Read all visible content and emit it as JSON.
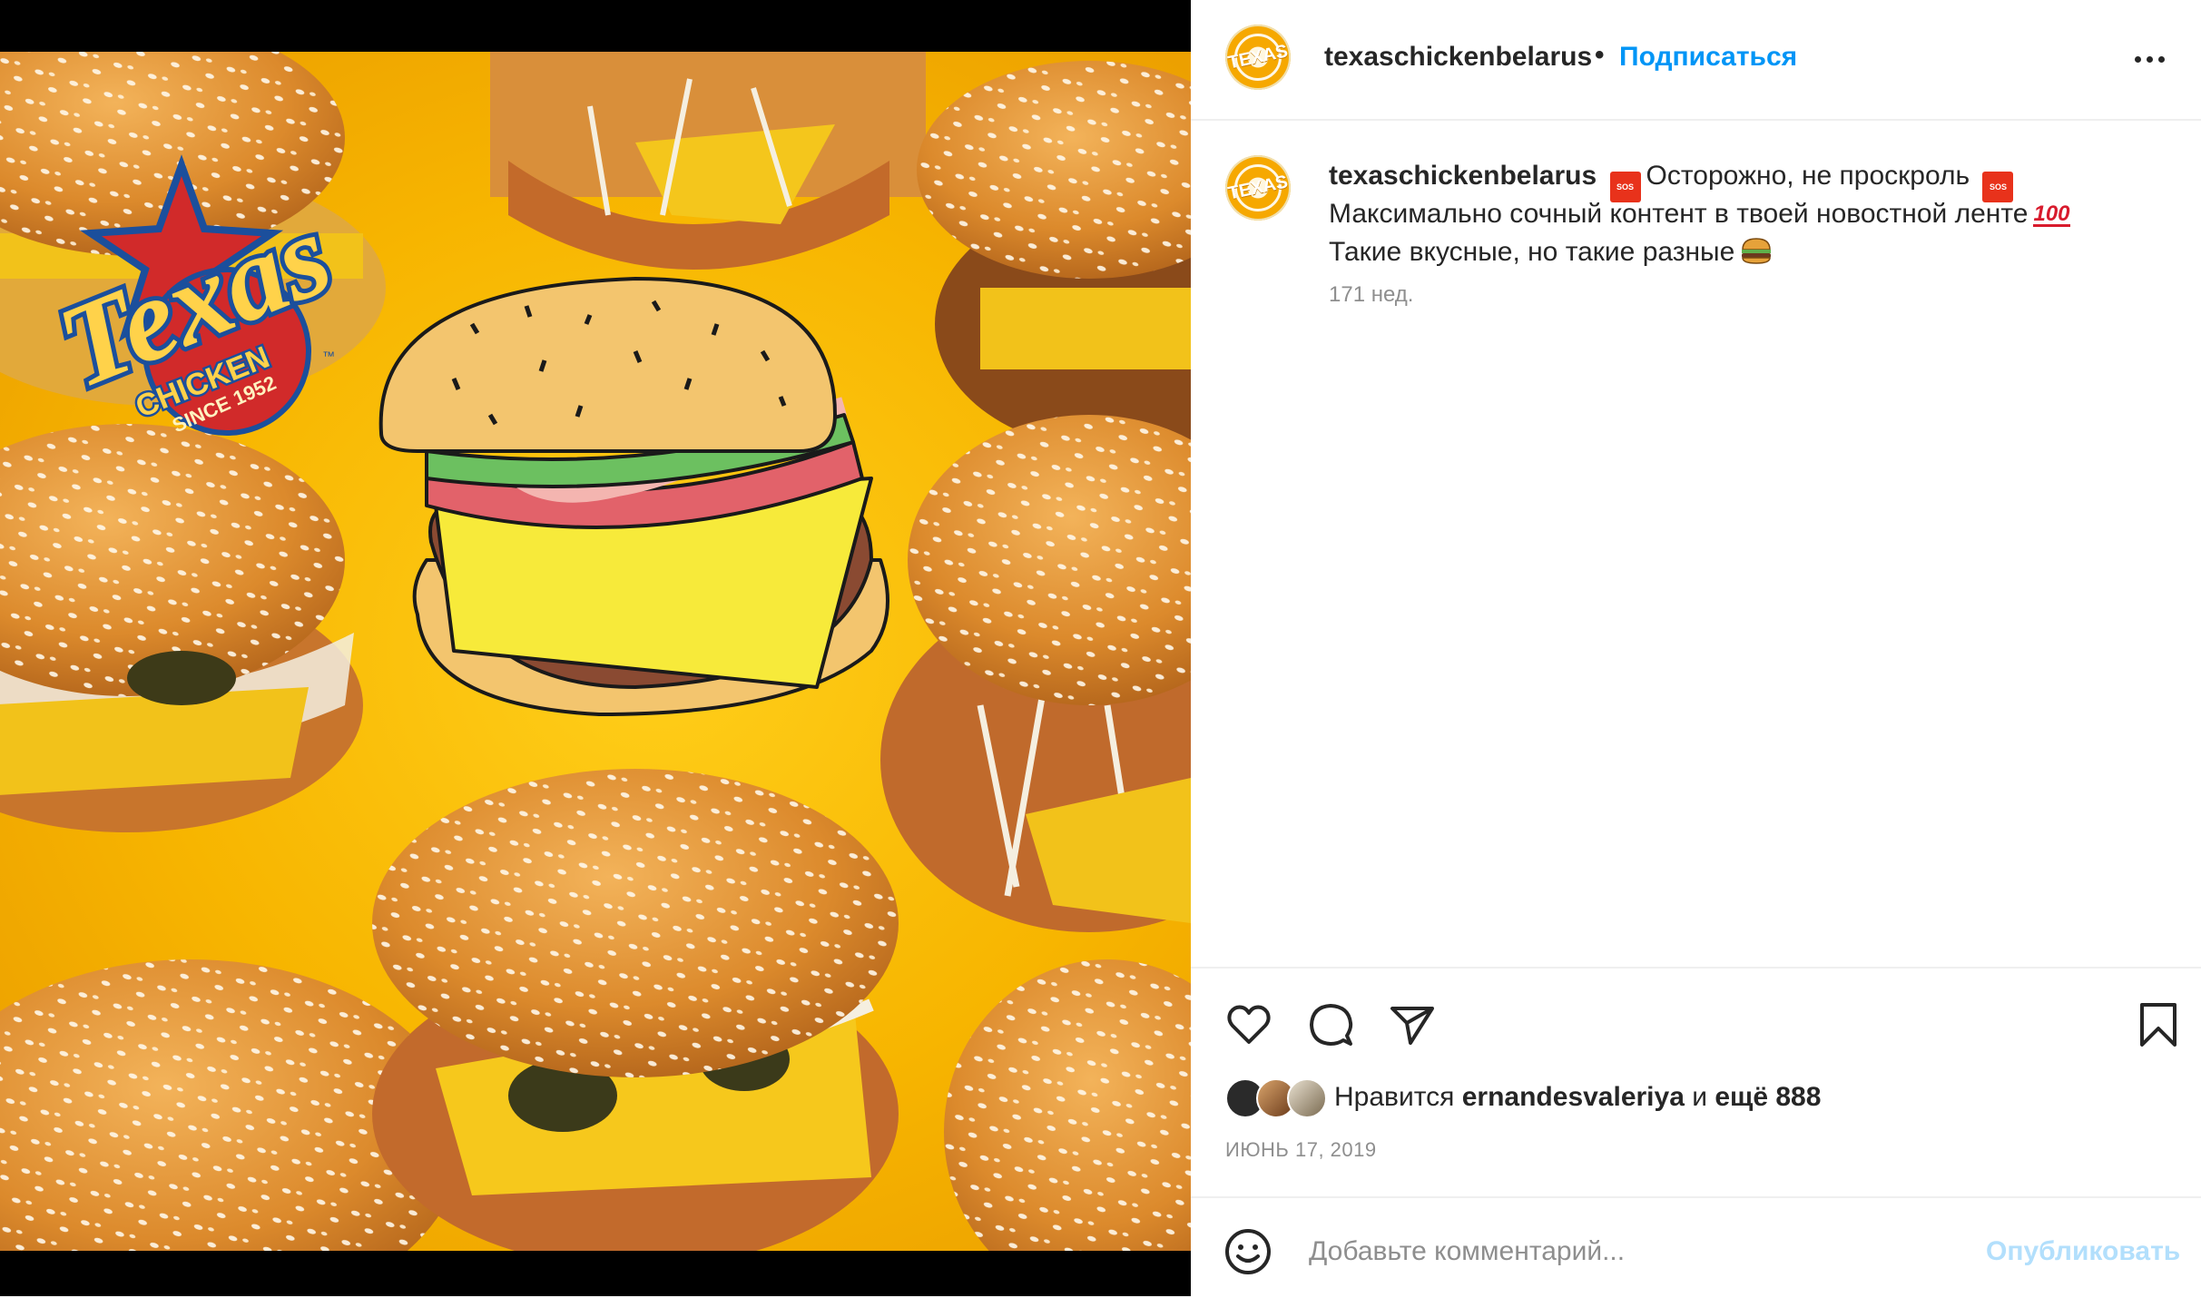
{
  "post": {
    "username": "texaschickenbelarus",
    "avatar_text": "TEXAS",
    "follow_label": "Подписаться",
    "separator": "•",
    "more_icon": "more-horizontal-icon"
  },
  "media": {
    "logo_word": "Texas",
    "logo_sub": "CHICKEN",
    "logo_since": "SINCE 1952",
    "logo_tm": "™"
  },
  "caption": {
    "username": "texaschickenbelarus",
    "line1": "Осторожно, не проскроль",
    "line2": "Максимально сочный контент в твоей новостной ленте",
    "line3": "Такие вкусные, но такие разные",
    "sos_label": "SOS",
    "hundred_label": "100",
    "time": "171 нед."
  },
  "actions": {
    "like_icon": "heart-icon",
    "comment_icon": "comment-icon",
    "share_icon": "share-icon",
    "save_icon": "bookmark-icon"
  },
  "likes": {
    "prefix": "Нравится",
    "user": "ernandesvaleriya",
    "middle": "и",
    "more": "ещё 888"
  },
  "date": "ИЮНЬ 17, 2019",
  "comment": {
    "placeholder": "Добавьте комментарий...",
    "publish_label": "Опубликовать"
  },
  "colors": {
    "accent": "#0095f6",
    "publish_disabled": "#b2dffc",
    "muted": "#8e8e8e",
    "background_yellow": "#f7b500"
  }
}
